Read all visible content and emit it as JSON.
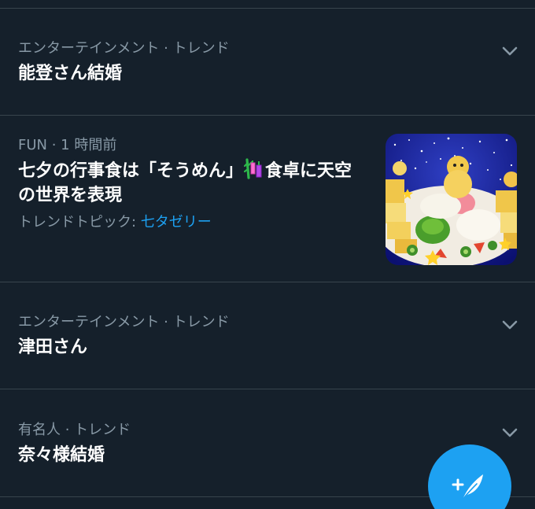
{
  "trends": [
    {
      "meta": "エンターテインメント · トレンド",
      "title": "能登さん結婚"
    },
    {
      "meta": "FUN · 1 時間前",
      "title_before_emoji": "七夕の行事食は「そうめん」",
      "title_after_emoji": "食卓に天空の世界を表現",
      "emoji": "tanabata-tree-icon",
      "topic_label": "トレンドトピック: ",
      "topic_link": "七タゼリー",
      "thumbnail": "somen-dish-image"
    },
    {
      "meta": "エンターテインメント · トレンド",
      "title": "津田さん"
    },
    {
      "meta": "有名人 · トレンド",
      "title": "奈々様結婚"
    }
  ],
  "icons": {
    "more": "chevron-down-icon",
    "compose": "compose-tweet-icon"
  },
  "colors": {
    "background": "#15202b",
    "divider": "#38444d",
    "secondary_text": "#8899a6",
    "accent": "#1da1f2"
  }
}
